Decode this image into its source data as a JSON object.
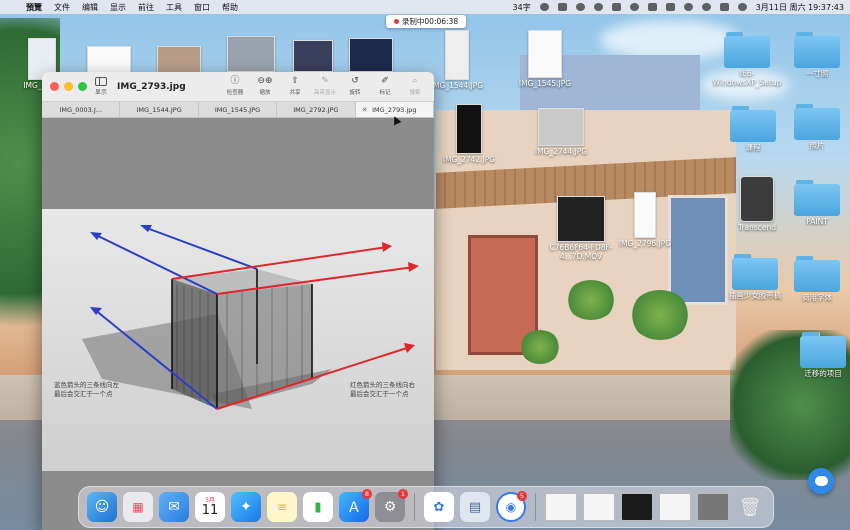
{
  "menubar": {
    "app_name": "預覽",
    "menu_items": [
      "文件",
      "编辑",
      "显示",
      "前往",
      "工具",
      "窗口",
      "帮助"
    ],
    "input_indicator": "34字",
    "date_time": "3月11日 周六  19:37:43"
  },
  "recording": {
    "label": "录制中00:06:38"
  },
  "desktop_top_thumbs": [
    {
      "label": "IMG_0003"
    },
    {
      "label": ""
    },
    {
      "label": ""
    },
    {
      "label": ""
    },
    {
      "label": ""
    },
    {
      "label": ""
    }
  ],
  "desktop_files": [
    {
      "label": "IMG_1544.JPG"
    },
    {
      "label": "IMG_1545.JPG"
    },
    {
      "label": "IMG_2742.JPG"
    },
    {
      "label": "IMG_2744.JPG"
    },
    {
      "label": "C76B6F64-FD8F-4...7D.MOV"
    },
    {
      "label": "IMG_2796.JPG"
    }
  ],
  "desktop_folders": [
    {
      "label": "IE6-WindowsXP_Setup"
    },
    {
      "label": "一寸照"
    },
    {
      "label": "课程"
    },
    {
      "label": "照片"
    },
    {
      "label": "Transcend"
    },
    {
      "label": "PAINT"
    },
    {
      "label": "插画少女胶带稿"
    },
    {
      "label": "商用字体"
    },
    {
      "label": "迁移的项目"
    }
  ],
  "window": {
    "title": "IMG_2793.jpg",
    "sidebar_label": "显示",
    "tools": [
      {
        "label": "检查器",
        "icon": "info-icon"
      },
      {
        "label": "缩放",
        "icon": "zoom-icon"
      },
      {
        "label": "共享",
        "icon": "share-icon"
      },
      {
        "label": "高亮显示",
        "icon": "highlight-icon"
      },
      {
        "label": "旋转",
        "icon": "rotate-icon"
      },
      {
        "label": "标记",
        "icon": "markup-icon"
      },
      {
        "label": "搜索",
        "icon": "search-icon"
      }
    ],
    "tabs": [
      "IMG_0003.J...",
      "IMG_1544.JPG",
      "IMG_1545.JPG",
      "IMG_2792.JPG",
      "IMG_2793.jpg"
    ],
    "active_tab": 4,
    "caption_left": [
      "蓝色箭头的三条线向左",
      "最后会交汇于一个点"
    ],
    "caption_right": [
      "红色箭头的三条线向右",
      "最后会交汇于一个点"
    ]
  },
  "dock": {
    "badges": {
      "calendar_date": "11",
      "appstore": "8",
      "settings": "1",
      "app3": "5"
    },
    "calendar_month": "3月"
  },
  "colors": {
    "blue_arrow": "#2a3fc8",
    "red_arrow": "#e0262b",
    "folder": "#5db3e6"
  }
}
